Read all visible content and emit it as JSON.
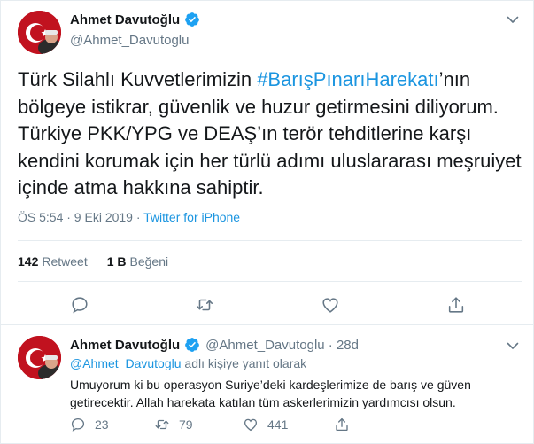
{
  "main_tweet": {
    "display_name": "Ahmet Davutoğlu",
    "handle": "@Ahmet_Davutoglu",
    "text_before": "Türk Silahlı Kuvvetlerimizin ",
    "hashtag": "#BarışPınarıHarekatı",
    "text_after": "’nın bölgeye istikrar, güvenlik ve huzur getirmesini diliyorum. Türkiye PKK/YPG ve DEAŞ’ın terör tehditlerine karşı kendini korumak için her türlü adımı uluslararası meşruiyet içinde atma hakkına sahiptir.",
    "timestamp": "ÖS 5:54 · 9 Eki 2019 · ",
    "source": "Twitter for iPhone",
    "retweet_count": "142",
    "retweet_label": "Retweet",
    "like_count": "1 B",
    "like_label": "Beğeni"
  },
  "reply_tweet": {
    "display_name": "Ahmet Davutoğlu",
    "handle_date": "@Ahmet_Davutoglu · 28d",
    "replying_mention": "@Ahmet_Davutoglu",
    "replying_suffix": " adlı kişiye yanıt olarak",
    "text": "Umuyorum ki bu operasyon Suriye’deki kardeşlerimize de barış ve güven getirecektir. Allah harekata katılan tüm askerlerimizin yardımcısı olsun.",
    "reply_count": "23",
    "retweet_count": "79",
    "like_count": "441"
  },
  "icons": [
    "verified-badge-icon",
    "chevron-down-icon",
    "reply-icon",
    "retweet-icon",
    "like-icon",
    "share-icon"
  ],
  "colors": {
    "link": "#1b95e0",
    "secondary_text": "#657786",
    "primary_text": "#14171a",
    "divider": "#e6ecf0",
    "avatar_red": "#c1121f"
  }
}
